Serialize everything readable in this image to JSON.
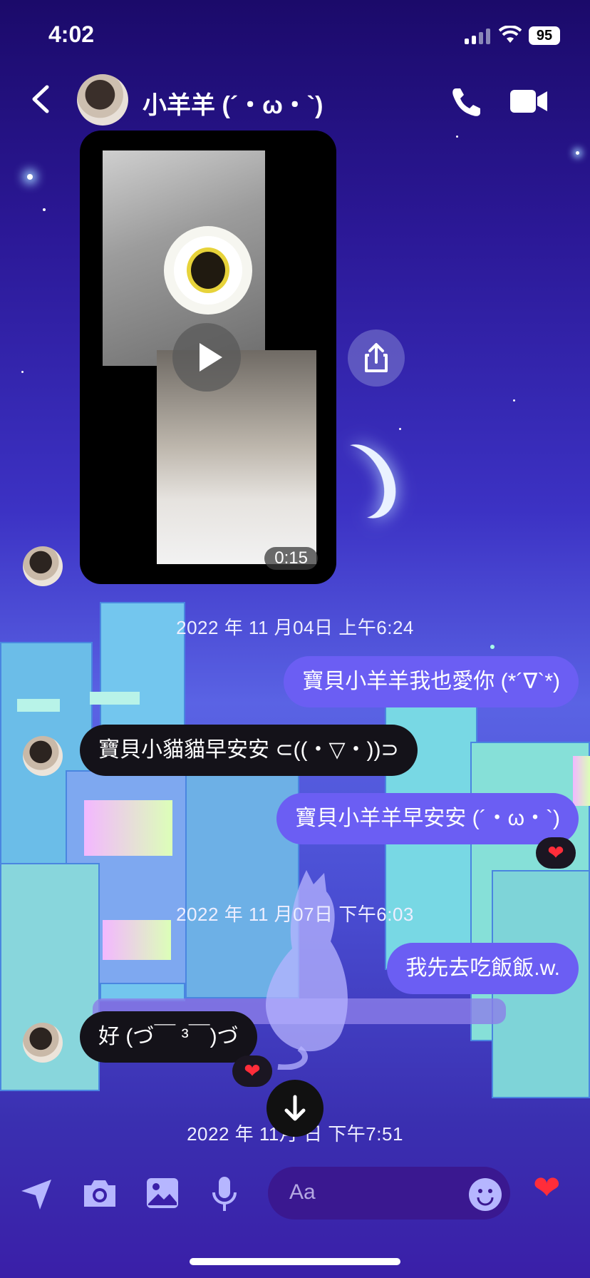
{
  "status_bar": {
    "time": "4:02",
    "battery": "95"
  },
  "header": {
    "contact_name": "小羊羊 (´・ω・`)"
  },
  "video_message": {
    "duration": "0:15"
  },
  "messages": [
    {
      "type": "timestamp",
      "text": "2022 年 11 月04日 上午6:24"
    },
    {
      "type": "outgoing",
      "text": "寶貝小羊羊我也愛你 (*´∇`*)"
    },
    {
      "type": "incoming",
      "text": "寶貝小貓貓早安安 ⊂((・▽・))⊃"
    },
    {
      "type": "outgoing",
      "text": "寶貝小羊羊早安安 (´・ω・`)",
      "reaction": "❤"
    },
    {
      "type": "timestamp",
      "text": "2022 年 11 月07日 下午6:03"
    },
    {
      "type": "outgoing",
      "text": "我先去吃飯飯.w."
    },
    {
      "type": "incoming",
      "text": "好 (づ￣ ³￣)づ",
      "reaction": "❤"
    },
    {
      "type": "timestamp",
      "text": "2022 年 11月 日 下午7:51"
    }
  ],
  "composer": {
    "placeholder": "Aa",
    "like": "❤"
  }
}
